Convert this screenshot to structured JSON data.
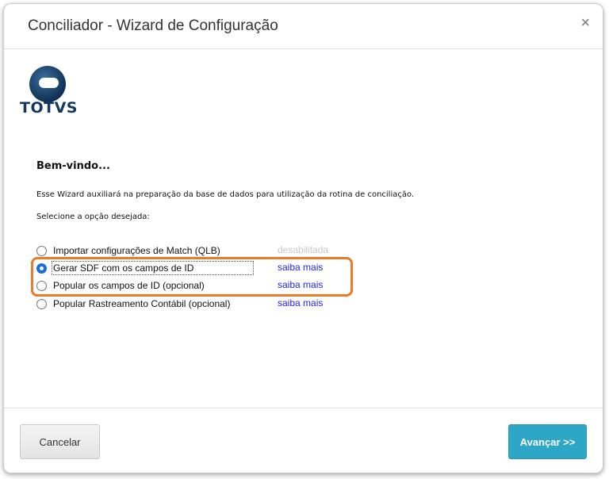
{
  "dialog": {
    "title": "Conciliador - Wizard de Configuração",
    "close_symbol": "×"
  },
  "logo": {
    "text": "TOTVS",
    "icon": "totvs-globe-logo"
  },
  "content": {
    "welcome": "Bem-vindo...",
    "description": "Esse Wizard auxiliará na preparação da base de dados para utilização da rotina de conciliação.",
    "prompt": "Selecione a opção desejada:",
    "options": [
      {
        "label": "Importar configurações de Match (QLB)",
        "link": "desabilitada",
        "selected": false,
        "link_enabled": false
      },
      {
        "label": "Gerar SDF com os campos de ID",
        "link": "saiba mais",
        "selected": true,
        "link_enabled": true
      },
      {
        "label": "Popular os campos de ID (opcional)",
        "link": "saiba mais",
        "selected": false,
        "link_enabled": true
      },
      {
        "label": "Popular Rastreamento Contábil (opcional)",
        "link": "saiba mais",
        "selected": false,
        "link_enabled": true
      }
    ]
  },
  "footer": {
    "cancel_label": "Cancelar",
    "next_label": "Avançar >>"
  },
  "colors": {
    "primary_button": "#2ea6c5",
    "link": "#1f1fff",
    "highlight": "#ec7a2a",
    "logo_text": "#14385f"
  }
}
